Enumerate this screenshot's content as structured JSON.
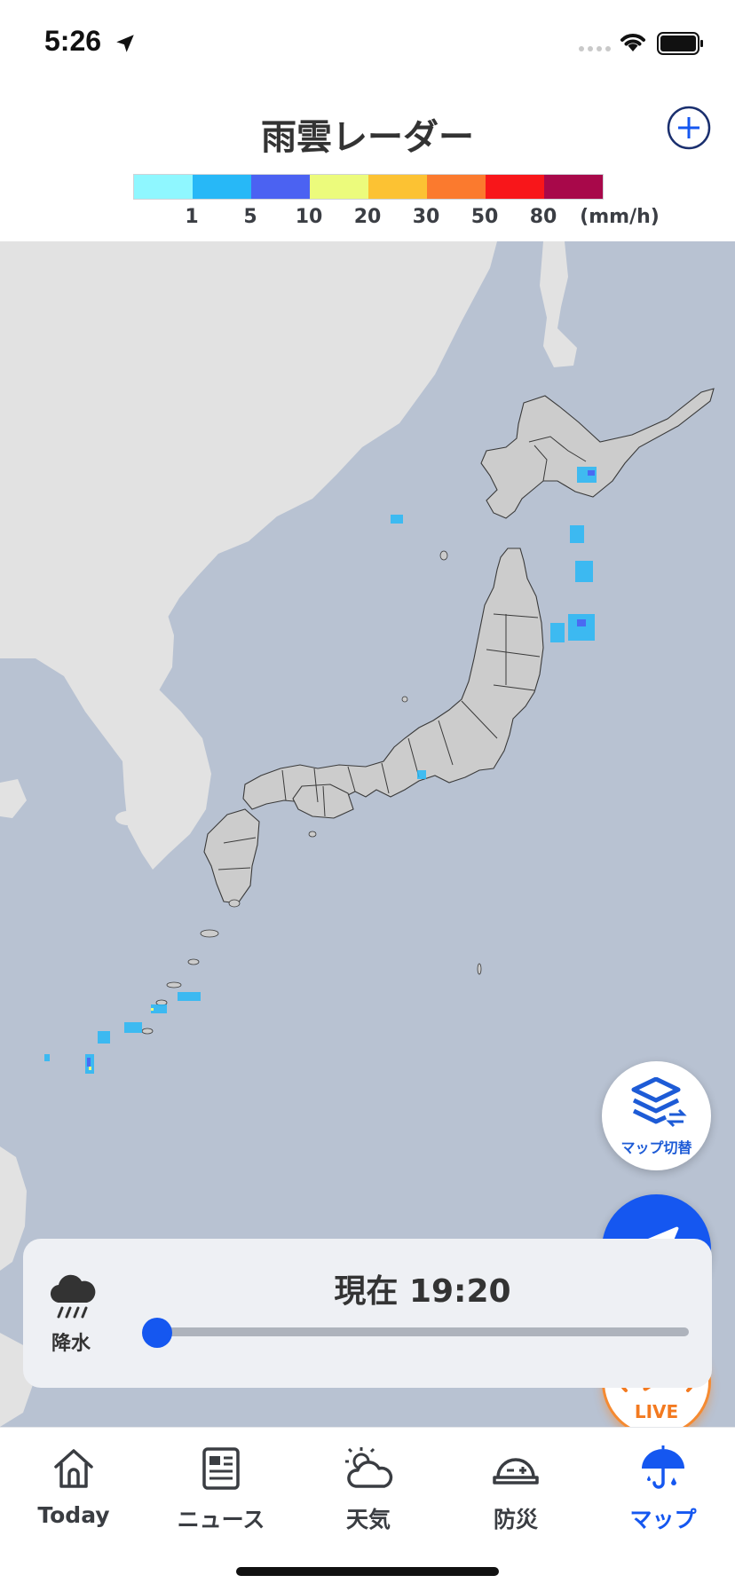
{
  "status": {
    "time": "5:26"
  },
  "header": {
    "title": "雨雲レーダー"
  },
  "legend": {
    "colors": [
      "#8ff7ff",
      "#27b8f7",
      "#4b62f2",
      "#ecfb7c",
      "#fcc233",
      "#fb7a2e",
      "#f8161a",
      "#a8084a"
    ],
    "labels": [
      "1",
      "5",
      "10",
      "20",
      "30",
      "50",
      "80",
      "(mm/h)"
    ]
  },
  "map_buttons": {
    "map_switch_label": "マップ切替",
    "live_label": "LIVE"
  },
  "time_panel": {
    "precip_label": "降水",
    "current_time": "現在 19:20",
    "slider_fraction": 0.0
  },
  "tabs": [
    {
      "label": "Today",
      "icon": "home-icon",
      "active": false
    },
    {
      "label": "ニュース",
      "icon": "news-icon",
      "active": false
    },
    {
      "label": "天気",
      "icon": "weather-icon",
      "active": false
    },
    {
      "label": "防災",
      "icon": "helmet-icon",
      "active": false
    },
    {
      "label": "マップ",
      "icon": "umbrella-map-icon",
      "active": true
    }
  ],
  "colors": {
    "accent": "#1557f0",
    "live": "#f58a31",
    "sea": "#b8c2d2",
    "land": "#e2e2e2",
    "japan": "#cccccc"
  }
}
